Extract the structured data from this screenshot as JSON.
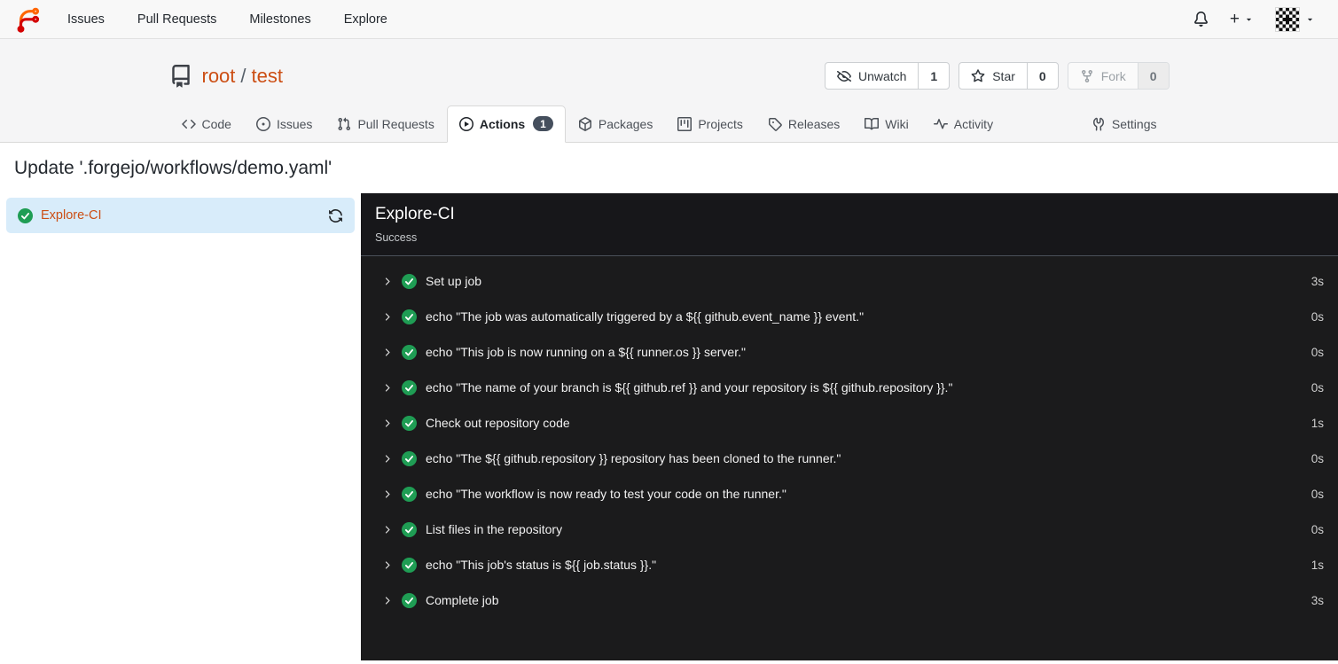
{
  "navbar": {
    "items": [
      "Issues",
      "Pull Requests",
      "Milestones",
      "Explore"
    ],
    "plus_label": "+",
    "icons": {
      "logo": "forgejo-logo",
      "bell": "bell-icon",
      "plus": "plus-icon",
      "avatar": "user-identicon-avatar",
      "caret": "chevron-down-icon"
    }
  },
  "repo_header": {
    "owner": "root",
    "separator": "/",
    "name": "test",
    "actions": {
      "watch": {
        "label": "Unwatch",
        "count": "1"
      },
      "star": {
        "label": "Star",
        "count": "0"
      },
      "fork": {
        "label": "Fork",
        "count": "0"
      }
    }
  },
  "tabs": {
    "items": [
      {
        "label": "Code"
      },
      {
        "label": "Issues"
      },
      {
        "label": "Pull Requests"
      },
      {
        "label": "Actions",
        "badge": "1",
        "active": true
      },
      {
        "label": "Packages"
      },
      {
        "label": "Projects"
      },
      {
        "label": "Releases"
      },
      {
        "label": "Wiki"
      },
      {
        "label": "Activity"
      },
      {
        "label": "Settings"
      }
    ]
  },
  "page": {
    "title": "Update '.forgejo/workflows/demo.yaml'"
  },
  "sidebar": {
    "job": {
      "name": "Explore-CI",
      "status": "success"
    }
  },
  "job_panel": {
    "title": "Explore-CI",
    "status": "Success",
    "steps": [
      {
        "name": "Set up job",
        "duration": "3s"
      },
      {
        "name": "echo \"The job was automatically triggered by a ${{ github.event_name }} event.\"",
        "duration": "0s"
      },
      {
        "name": "echo \"This job is now running on a ${{ runner.os }} server.\"",
        "duration": "0s"
      },
      {
        "name": "echo \"The name of your branch is ${{ github.ref }} and your repository is ${{ github.repository }}.\"",
        "duration": "0s"
      },
      {
        "name": "Check out repository code",
        "duration": "1s"
      },
      {
        "name": "echo \"The ${{ github.repository }} repository has been cloned to the runner.\"",
        "duration": "0s"
      },
      {
        "name": "echo \"The workflow is now ready to test your code on the runner.\"",
        "duration": "0s"
      },
      {
        "name": "List files in the repository",
        "duration": "0s"
      },
      {
        "name": "echo \"This job's status is ${{ job.status }}.\"",
        "duration": "1s"
      },
      {
        "name": "Complete job",
        "duration": "3s"
      }
    ]
  },
  "colors": {
    "primary": "#cc4e14",
    "success_green": "#1f9d54",
    "panel_bg": "#1b1b1c",
    "selected_job_bg": "#d8ecfa",
    "badge_bg": "#454f5d"
  }
}
